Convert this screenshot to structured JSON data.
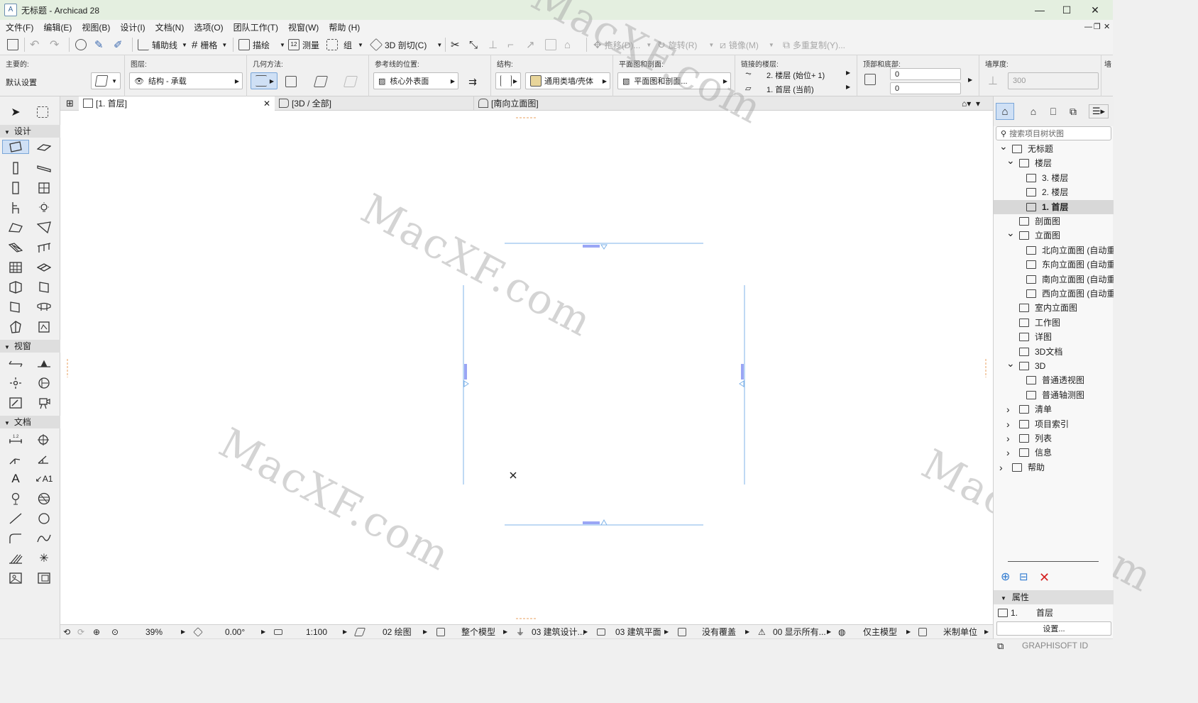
{
  "window": {
    "title": "无标题 - Archicad 28",
    "minimize": "—",
    "maximize": "☐",
    "close": "✕"
  },
  "menu": [
    {
      "label": "文件(F)"
    },
    {
      "label": "编辑(E)"
    },
    {
      "label": "视图(B)"
    },
    {
      "label": "设计(I)"
    },
    {
      "label": "文档(N)"
    },
    {
      "label": "选项(O)"
    },
    {
      "label": "团队工作(T)"
    },
    {
      "label": "视窗(W)"
    },
    {
      "label": "帮助 (H)"
    }
  ],
  "toolbar": {
    "guides": "辅助线",
    "grid": "栅格",
    "trace": "描绘",
    "measure": "测量",
    "group": "组",
    "cut3d": "3D 剖切(C)",
    "drag": "拖移(D)...",
    "rotate": "旋转(R)",
    "mirror": "镜像(M)",
    "multiply": "多重复制(Y)..."
  },
  "infobox": {
    "main_label": "主要的:",
    "main_value": "默认设置",
    "layer_label": "图层:",
    "layer_value": "结构 - 承载",
    "geometry_label": "几何方法:",
    "refline_label": "参考线的位置:",
    "refline_value": "核心外表面",
    "structure_label": "结构:",
    "structure_value": "通用类墙/壳体",
    "floorplan_label": "平面图和剖面:",
    "floorplan_value": "平面图和剖面...",
    "linked_label": "链接的楼层:",
    "linked_top": "2. 楼层 (始位+ 1)",
    "linked_bottom": "1. 首层 (当前)",
    "topbottom_label": "顶部和底部:",
    "top_value": "0",
    "bottom_value": "0",
    "thickness_label": "墙厚度:",
    "thickness_value": "300",
    "extra_label": "墙"
  },
  "toolbox": {
    "section_design": "设计",
    "section_viewport": "视窗",
    "section_document": "文档"
  },
  "tabs": [
    {
      "label": "[1. 首层]"
    },
    {
      "label": "[3D / 全部]"
    },
    {
      "label": "[南向立面图]"
    }
  ],
  "statusbar": {
    "zoom": "39%",
    "angle": "0.00°",
    "scale": "1:100",
    "layer_combo": "02 绘图",
    "model_view": "整个模型",
    "pen_set": "03 建筑设计...",
    "mvo": "03 建筑平面",
    "override": "没有覆盖",
    "renovation": "00 显示所有...",
    "structural": "仅主模型",
    "units": "米制单位"
  },
  "navigator": {
    "search_placeholder": "搜索项目树状图",
    "tree": [
      {
        "label": "无标题",
        "level": 0,
        "chev": "v"
      },
      {
        "label": "楼层",
        "level": 1,
        "chev": "v"
      },
      {
        "label": "3. 楼层",
        "level": 2,
        "chev": ""
      },
      {
        "label": "2. 楼层",
        "level": 2,
        "chev": ""
      },
      {
        "label": "1. 首层",
        "level": 2,
        "chev": "",
        "selected": true
      },
      {
        "label": "剖面图",
        "level": 1,
        "chev": ""
      },
      {
        "label": "立面图",
        "level": 1,
        "chev": "v"
      },
      {
        "label": "北向立面图 (自动重建",
        "level": 2,
        "chev": ""
      },
      {
        "label": "东向立面图 (自动重建",
        "level": 2,
        "chev": ""
      },
      {
        "label": "南向立面图 (自动重建",
        "level": 2,
        "chev": ""
      },
      {
        "label": "西向立面图 (自动重建",
        "level": 2,
        "chev": ""
      },
      {
        "label": "室内立面图",
        "level": 1,
        "chev": ""
      },
      {
        "label": "工作图",
        "level": 1,
        "chev": ""
      },
      {
        "label": "详图",
        "level": 1,
        "chev": ""
      },
      {
        "label": "3D文档",
        "level": 1,
        "chev": ""
      },
      {
        "label": "3D",
        "level": 1,
        "chev": "v"
      },
      {
        "label": "普通透视图",
        "level": 2,
        "chev": ""
      },
      {
        "label": "普通轴测图",
        "level": 2,
        "chev": ""
      },
      {
        "label": "清单",
        "level": 1,
        "chev": ">"
      },
      {
        "label": "项目索引",
        "level": 1,
        "chev": ">"
      },
      {
        "label": "列表",
        "level": 1,
        "chev": ">"
      },
      {
        "label": "信息",
        "level": 1,
        "chev": ">"
      },
      {
        "label": "帮助",
        "level": 0,
        "chev": ">"
      }
    ],
    "properties_label": "属性",
    "prop_id": "1.",
    "prop_name": "首层",
    "settings_button": "设置...",
    "brand": "GRAPHISOFT ID"
  },
  "watermark": "MacXF.com",
  "colors": {
    "elevation_marker": "#9aa6f5",
    "line": "#5b9bd5",
    "selection": "#cfe0f5"
  }
}
